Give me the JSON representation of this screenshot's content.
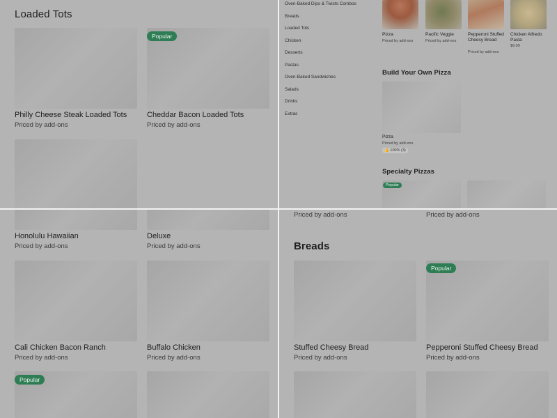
{
  "top_left": {
    "section_title": "Loaded Tots",
    "items": [
      {
        "title": "Philly Cheese Steak Loaded Tots",
        "subtitle": "Priced by add-ons"
      },
      {
        "title": "Cheddar Bacon Loaded Tots",
        "subtitle": "Priced by add-ons",
        "badge": "Popular"
      }
    ]
  },
  "top_right": {
    "categories": [
      "Oven-Baked Dips & Twists Combos",
      "Breads",
      "Loaded Tots",
      "Chicken",
      "Desserts",
      "Pastas",
      "Oven-Baked Sandwiches",
      "Salads",
      "Drinks",
      "Extras"
    ],
    "featured": [
      {
        "title": "Pizza",
        "subtitle": "Priced by add-ons",
        "thumb": "pizza"
      },
      {
        "title": "Pacific Veggie",
        "subtitle": "Priced by add-ons",
        "thumb": "veggie"
      },
      {
        "title": "Pepperoni Stuffed Cheesy Bread",
        "subtitle": "Priced by add-ons",
        "thumb": "pepperoni"
      },
      {
        "title": "Chicken Alfredo Pasta",
        "subtitle": "$9.09",
        "thumb": "alfredo"
      }
    ],
    "build_title": "Build Your Own Pizza",
    "build_item": {
      "title": "Pizza",
      "subtitle": "Priced by add-ons",
      "rating": "100% (3)"
    },
    "specialty_title": "Specialty Pizzas",
    "specialty_badge": "Popular"
  },
  "bottom_left": {
    "items": [
      {
        "title": "Honolulu Hawaiian",
        "subtitle": "Priced by add-ons"
      },
      {
        "title": "Deluxe",
        "subtitle": "Priced by add-ons"
      },
      {
        "title": "Cali Chicken Bacon Ranch",
        "subtitle": "Priced by add-ons"
      },
      {
        "title": "Buffalo Chicken",
        "subtitle": "Priced by add-ons"
      }
    ],
    "badge": "Popular"
  },
  "bottom_right": {
    "top_subtitles": [
      "Priced by add-ons",
      "Priced by add-ons"
    ],
    "section_title": "Breads",
    "items": [
      {
        "title": "Stuffed Cheesy Bread",
        "subtitle": "Priced by add-ons"
      },
      {
        "title": "Pepperoni Stuffed Cheesy Bread",
        "subtitle": "Priced by add-ons",
        "badge": "Popular"
      }
    ]
  }
}
